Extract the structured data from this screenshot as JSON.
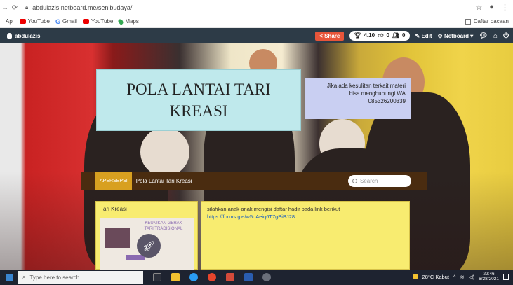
{
  "browser": {
    "url": "abdulazis.netboard.me/senibudaya/",
    "bookmarks": [
      {
        "label": "Api",
        "icon": "apps-icon"
      },
      {
        "label": "YouTube",
        "icon": "youtube-icon"
      },
      {
        "label": "Gmail",
        "icon": "google-icon"
      },
      {
        "label": "YouTube",
        "icon": "youtube-icon"
      },
      {
        "label": "Maps",
        "icon": "maps-icon"
      }
    ],
    "reading_list": "Daftar bacaan"
  },
  "site_nav": {
    "username": "abdulazis",
    "share_label": "Share",
    "stats": {
      "rating": "4.10",
      "likes": "0",
      "followers": "0"
    },
    "edit_label": "Edit",
    "netboard_label": "Netboard"
  },
  "page": {
    "title_line1": "POLA LANTAI TARI",
    "title_line2": "KREASI",
    "contact_line1": "Jika ada kesulitan terkait materi",
    "contact_line2": "bisa menghubungi WA",
    "contact_line3": "085326200339",
    "toolbar": {
      "tab": "APERSEPSI",
      "title": "Pola Lantai Tari Kreasi",
      "search_placeholder": "Search"
    },
    "card_left": {
      "header": "Tari Kreasi",
      "thumb_text_line1": "KEUNIKAN GERAK",
      "thumb_text_line2": "TARI TRADISIONAL"
    },
    "card_right": {
      "text": "silahkan anak-anak mengisi daftar hadir pada link berikut",
      "link": "https://forms.gle/w5oAeiq6T7gBiBJ28"
    }
  },
  "taskbar": {
    "search_placeholder": "Type here to search",
    "weather": "28°C  Kabut",
    "time": "22:46",
    "date": "6/28/2021"
  },
  "colors": {
    "site_nav_bg": "#2d3b47",
    "share": "#e7553a",
    "title_box": "#bfe9ec",
    "contact_box": "#c9cff2",
    "toolbar_bg": "#4a2c10",
    "tab_apersepsi": "#d8a020",
    "card_bg": "#f8ec70",
    "taskbar_bg": "#1e2330"
  }
}
